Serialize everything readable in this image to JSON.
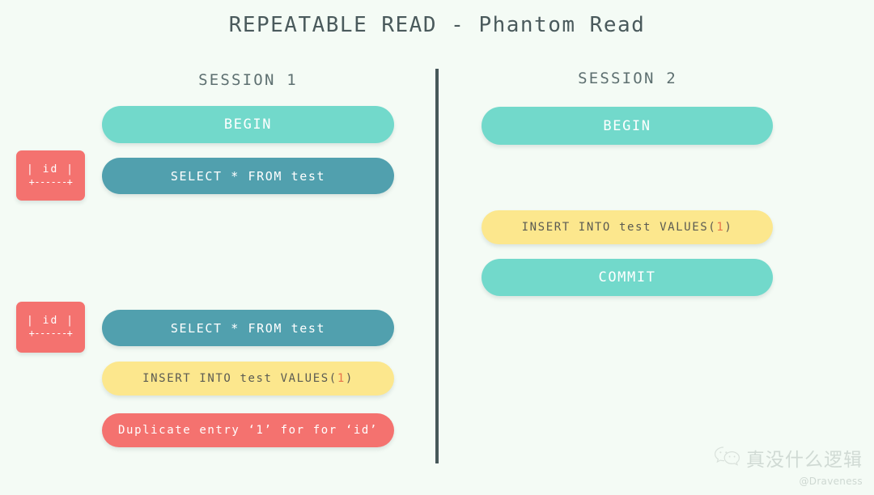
{
  "page": {
    "title": "REPEATABLE READ - Phantom Read",
    "background_color": "#f4fbf5"
  },
  "colors": {
    "mint": "#72d9cb",
    "slate": "#51a0ae",
    "yellow": "#fce78d",
    "red": "#f4726f",
    "divider": "#47585a",
    "title_text": "#4a5a5c",
    "number_highlight": "#e8734a"
  },
  "sessions": [
    {
      "header": "SESSION 1",
      "steps": [
        {
          "label": "BEGIN",
          "style": "mint"
        },
        {
          "label": "SELECT * FROM test",
          "style": "slate"
        },
        {
          "label": "SELECT * FROM test",
          "style": "slate"
        },
        {
          "label": "INSERT INTO test VALUES(",
          "style": "yellow",
          "value": "1",
          "suffix": ")"
        },
        {
          "label": "Duplicate entry ‘1’ for for ‘id’",
          "style": "red"
        }
      ]
    },
    {
      "header": "SESSION 2",
      "steps": [
        {
          "label": "BEGIN",
          "style": "mint"
        },
        {
          "label": "INSERT INTO test VALUES(",
          "style": "yellow",
          "value": "1",
          "suffix": ")"
        },
        {
          "label": "COMMIT",
          "style": "mint"
        }
      ]
    }
  ],
  "result_boxes": [
    {
      "row1": "| id |",
      "row2": "+------+"
    },
    {
      "row1": "| id |",
      "row2": "+------+"
    }
  ],
  "watermark": {
    "account_name": "真没什么逻辑",
    "handle": "@Draveness",
    "icon": "wechat-icon"
  }
}
